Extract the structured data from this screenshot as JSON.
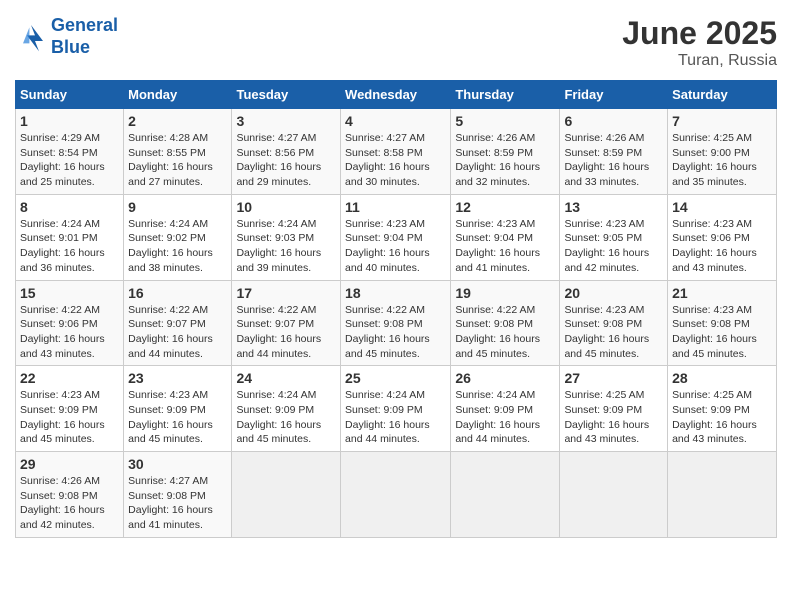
{
  "logo": {
    "line1": "General",
    "line2": "Blue"
  },
  "title": "June 2025",
  "subtitle": "Turan, Russia",
  "weekdays": [
    "Sunday",
    "Monday",
    "Tuesday",
    "Wednesday",
    "Thursday",
    "Friday",
    "Saturday"
  ],
  "weeks": [
    [
      {
        "day": "1",
        "sunrise": "4:29 AM",
        "sunset": "8:54 PM",
        "daylight": "16 hours and 25 minutes."
      },
      {
        "day": "2",
        "sunrise": "4:28 AM",
        "sunset": "8:55 PM",
        "daylight": "16 hours and 27 minutes."
      },
      {
        "day": "3",
        "sunrise": "4:27 AM",
        "sunset": "8:56 PM",
        "daylight": "16 hours and 29 minutes."
      },
      {
        "day": "4",
        "sunrise": "4:27 AM",
        "sunset": "8:58 PM",
        "daylight": "16 hours and 30 minutes."
      },
      {
        "day": "5",
        "sunrise": "4:26 AM",
        "sunset": "8:59 PM",
        "daylight": "16 hours and 32 minutes."
      },
      {
        "day": "6",
        "sunrise": "4:26 AM",
        "sunset": "8:59 PM",
        "daylight": "16 hours and 33 minutes."
      },
      {
        "day": "7",
        "sunrise": "4:25 AM",
        "sunset": "9:00 PM",
        "daylight": "16 hours and 35 minutes."
      }
    ],
    [
      {
        "day": "8",
        "sunrise": "4:24 AM",
        "sunset": "9:01 PM",
        "daylight": "16 hours and 36 minutes."
      },
      {
        "day": "9",
        "sunrise": "4:24 AM",
        "sunset": "9:02 PM",
        "daylight": "16 hours and 38 minutes."
      },
      {
        "day": "10",
        "sunrise": "4:24 AM",
        "sunset": "9:03 PM",
        "daylight": "16 hours and 39 minutes."
      },
      {
        "day": "11",
        "sunrise": "4:23 AM",
        "sunset": "9:04 PM",
        "daylight": "16 hours and 40 minutes."
      },
      {
        "day": "12",
        "sunrise": "4:23 AM",
        "sunset": "9:04 PM",
        "daylight": "16 hours and 41 minutes."
      },
      {
        "day": "13",
        "sunrise": "4:23 AM",
        "sunset": "9:05 PM",
        "daylight": "16 hours and 42 minutes."
      },
      {
        "day": "14",
        "sunrise": "4:23 AM",
        "sunset": "9:06 PM",
        "daylight": "16 hours and 43 minutes."
      }
    ],
    [
      {
        "day": "15",
        "sunrise": "4:22 AM",
        "sunset": "9:06 PM",
        "daylight": "16 hours and 43 minutes."
      },
      {
        "day": "16",
        "sunrise": "4:22 AM",
        "sunset": "9:07 PM",
        "daylight": "16 hours and 44 minutes."
      },
      {
        "day": "17",
        "sunrise": "4:22 AM",
        "sunset": "9:07 PM",
        "daylight": "16 hours and 44 minutes."
      },
      {
        "day": "18",
        "sunrise": "4:22 AM",
        "sunset": "9:08 PM",
        "daylight": "16 hours and 45 minutes."
      },
      {
        "day": "19",
        "sunrise": "4:22 AM",
        "sunset": "9:08 PM",
        "daylight": "16 hours and 45 minutes."
      },
      {
        "day": "20",
        "sunrise": "4:23 AM",
        "sunset": "9:08 PM",
        "daylight": "16 hours and 45 minutes."
      },
      {
        "day": "21",
        "sunrise": "4:23 AM",
        "sunset": "9:08 PM",
        "daylight": "16 hours and 45 minutes."
      }
    ],
    [
      {
        "day": "22",
        "sunrise": "4:23 AM",
        "sunset": "9:09 PM",
        "daylight": "16 hours and 45 minutes."
      },
      {
        "day": "23",
        "sunrise": "4:23 AM",
        "sunset": "9:09 PM",
        "daylight": "16 hours and 45 minutes."
      },
      {
        "day": "24",
        "sunrise": "4:24 AM",
        "sunset": "9:09 PM",
        "daylight": "16 hours and 45 minutes."
      },
      {
        "day": "25",
        "sunrise": "4:24 AM",
        "sunset": "9:09 PM",
        "daylight": "16 hours and 44 minutes."
      },
      {
        "day": "26",
        "sunrise": "4:24 AM",
        "sunset": "9:09 PM",
        "daylight": "16 hours and 44 minutes."
      },
      {
        "day": "27",
        "sunrise": "4:25 AM",
        "sunset": "9:09 PM",
        "daylight": "16 hours and 43 minutes."
      },
      {
        "day": "28",
        "sunrise": "4:25 AM",
        "sunset": "9:09 PM",
        "daylight": "16 hours and 43 minutes."
      }
    ],
    [
      {
        "day": "29",
        "sunrise": "4:26 AM",
        "sunset": "9:08 PM",
        "daylight": "16 hours and 42 minutes."
      },
      {
        "day": "30",
        "sunrise": "4:27 AM",
        "sunset": "9:08 PM",
        "daylight": "16 hours and 41 minutes."
      },
      null,
      null,
      null,
      null,
      null
    ]
  ]
}
